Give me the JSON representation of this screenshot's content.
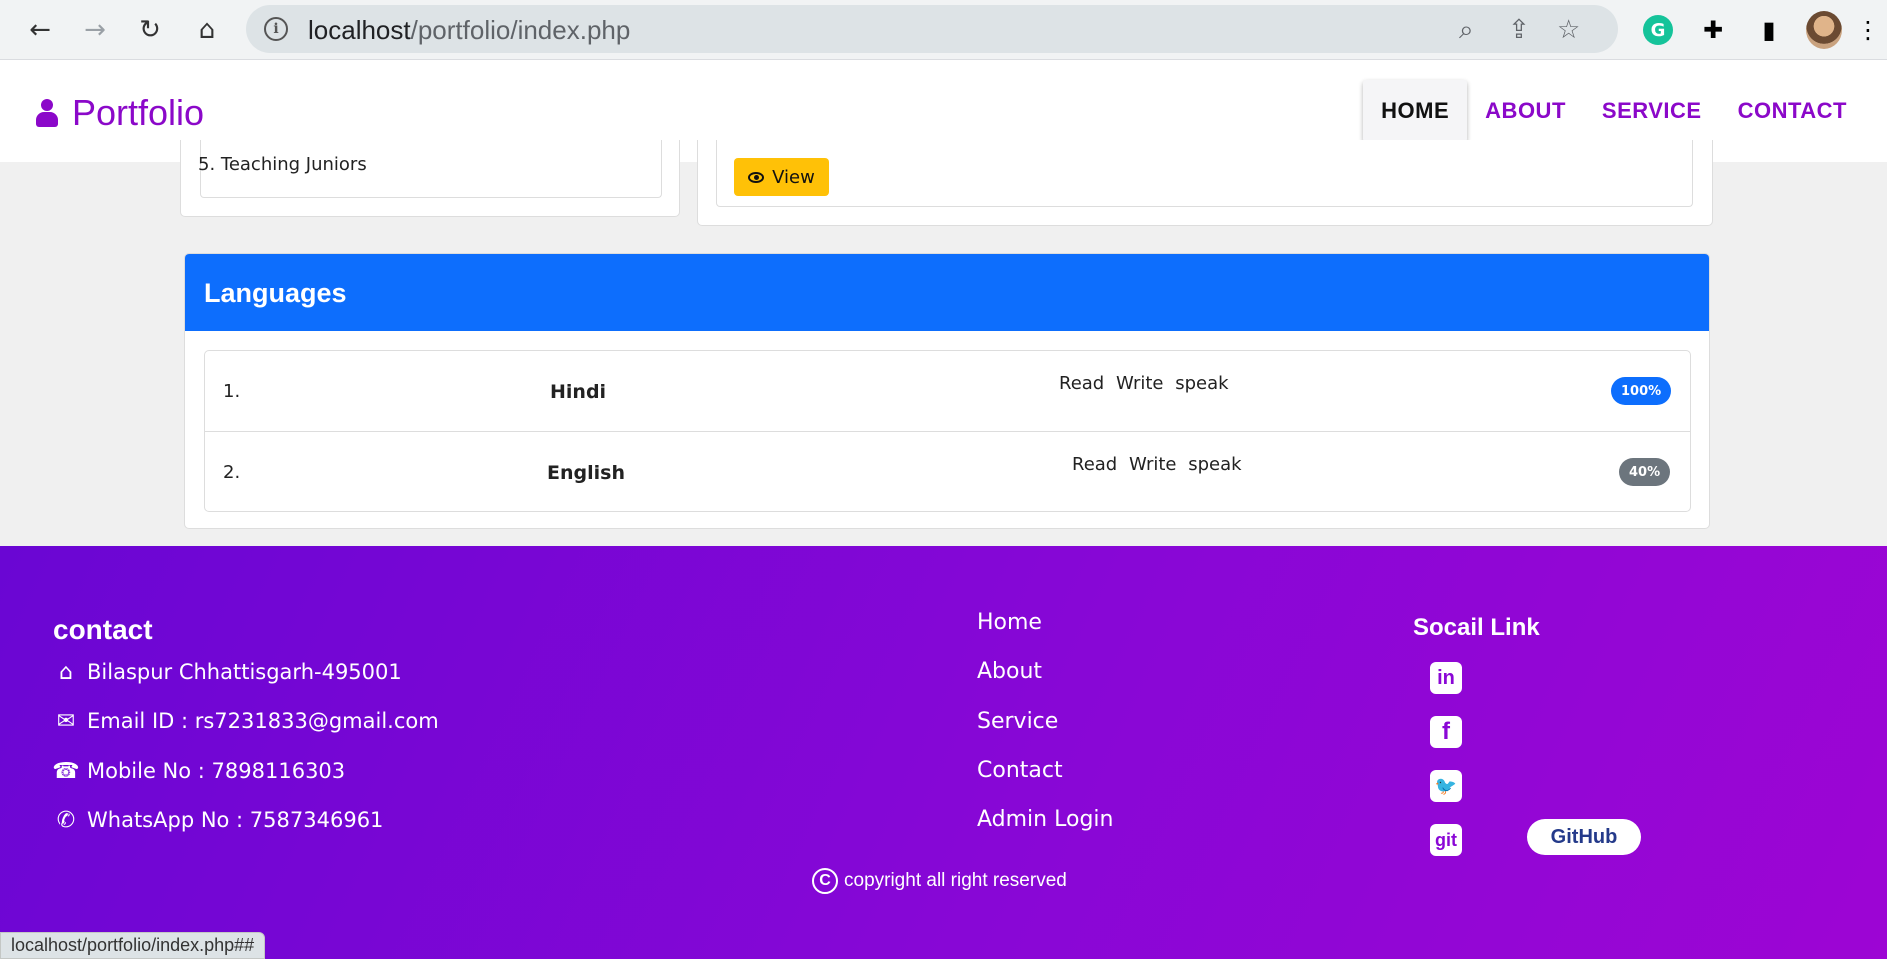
{
  "browser": {
    "url_host": "localhost",
    "url_path": "/portfolio/index.php",
    "status_url": "localhost/portfolio/index.php##"
  },
  "site": {
    "brand": "Portfolio",
    "nav": [
      {
        "label": "HOME",
        "active": true
      },
      {
        "label": "ABOUT"
      },
      {
        "label": "SERVICE"
      },
      {
        "label": "CONTACT"
      }
    ]
  },
  "cards": {
    "teaching_item": "5. Teaching Juniors",
    "view_label": "View"
  },
  "languages": {
    "title": "Languages",
    "rows": [
      {
        "num": "1.",
        "name": "Hindi",
        "skills": "Read Write speak",
        "level": "100%",
        "badge_color": "#0d6efd"
      },
      {
        "num": "2.",
        "name": "English",
        "skills": "Read Write speak",
        "level": "40%",
        "badge_color": "#6c757d"
      }
    ]
  },
  "footer": {
    "contact_title": "contact",
    "address": "Bilaspur Chhattisgarh-495001",
    "email": "Email ID : rs7231833@gmail.com",
    "mobile": "Mobile No : 7898116303",
    "whatsapp": "WhatsApp No : 7587346961",
    "links": [
      "Home",
      "About",
      "Service",
      "Contact",
      "Admin Login"
    ],
    "social_title": "Socail Link",
    "social_icons": [
      "linkedin-icon",
      "facebook-icon",
      "twitter-icon",
      "git-icon"
    ],
    "git_text": "git",
    "github_label": "GitHub",
    "copyright": "copyright all right reserved"
  }
}
